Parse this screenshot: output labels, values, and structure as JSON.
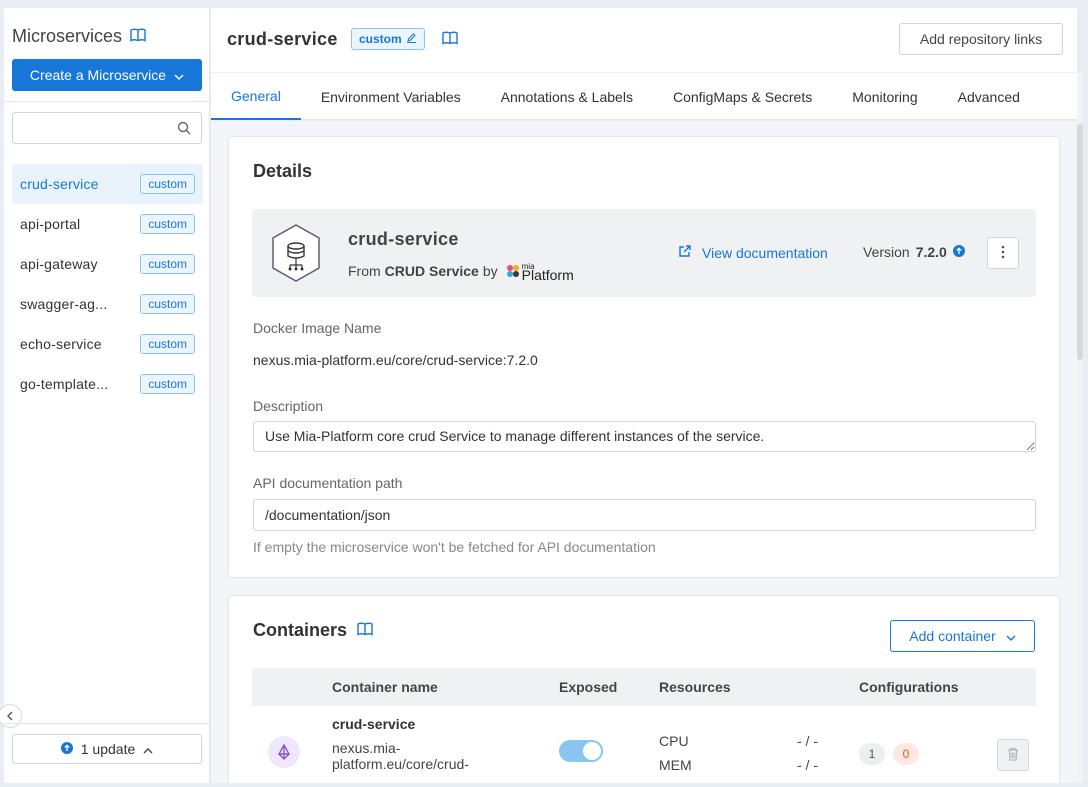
{
  "sidebar": {
    "title": "Microservices",
    "create_label": "Create a Microservice",
    "search_placeholder": "",
    "items": [
      {
        "name": "crud-service",
        "badge": "custom"
      },
      {
        "name": "api-portal",
        "badge": "custom"
      },
      {
        "name": "api-gateway",
        "badge": "custom"
      },
      {
        "name": "swagger-ag...",
        "badge": "custom"
      },
      {
        "name": "echo-service",
        "badge": "custom"
      },
      {
        "name": "go-template...",
        "badge": "custom"
      }
    ],
    "update_label": "1 update"
  },
  "header": {
    "title": "crud-service",
    "badge": "custom",
    "repo_button": "Add repository links"
  },
  "tabs": [
    "General",
    "Environment Variables",
    "Annotations & Labels",
    "ConfigMaps & Secrets",
    "Monitoring",
    "Advanced"
  ],
  "details": {
    "title": "Details",
    "service_name": "crud-service",
    "from_prefix": "From",
    "from_source": "CRUD Service",
    "by": "by",
    "brand_small": "mia",
    "brand": "Platform",
    "view_doc": "View documentation",
    "version_label": "Version",
    "version": "7.2.0",
    "docker_label": "Docker Image Name",
    "docker_value": "nexus.mia-platform.eu/core/crud-service:7.2.0",
    "description_label": "Description",
    "description_value": "Use Mia-Platform core crud Service to manage different instances of the service.",
    "api_doc_label": "API documentation path",
    "api_doc_value": "/documentation/json",
    "api_doc_hint": "If empty the microservice won't be fetched for API documentation"
  },
  "containers": {
    "title": "Containers",
    "add_label": "Add container",
    "columns": [
      "Container name",
      "Exposed",
      "Resources",
      "Configurations"
    ],
    "rows": [
      {
        "name": "crud-service",
        "image_line1": "nexus.mia-",
        "image_line2": "platform.eu/core/crud-",
        "exposed": true,
        "cpu_label": "CPU",
        "cpu_value": "- / -",
        "mem_label": "MEM",
        "mem_value": "- / -",
        "config_count_a": "1",
        "config_count_b": "0"
      }
    ]
  },
  "colors": {
    "accent": "#1677d9",
    "badge_bg": "#eaf5fe",
    "toggle": "#8cc4f0"
  }
}
